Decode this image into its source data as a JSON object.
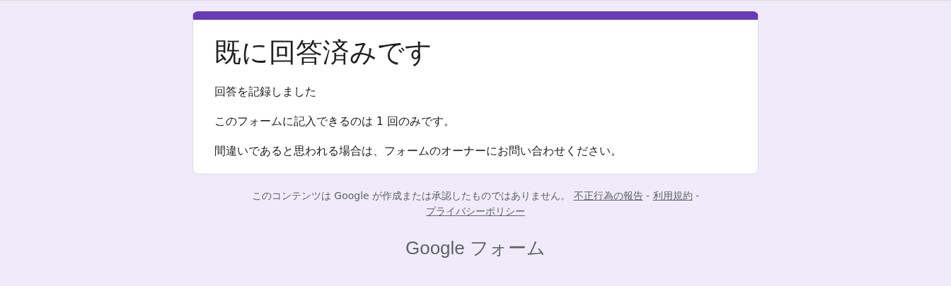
{
  "card": {
    "title": "既に回答済みです",
    "messages": [
      "回答を記録しました",
      "このフォームに記入できるのは 1 回のみです。",
      "間違いであると思われる場合は、フォームのオーナーにお問い合わせください。"
    ]
  },
  "footer": {
    "disclaimer": "このコンテンツは Google が作成または承認したものではありません。",
    "separator": "-",
    "links": [
      "不正行為の報告",
      "利用規約",
      "プライバシーポリシー"
    ]
  },
  "brand": "Google フォーム"
}
